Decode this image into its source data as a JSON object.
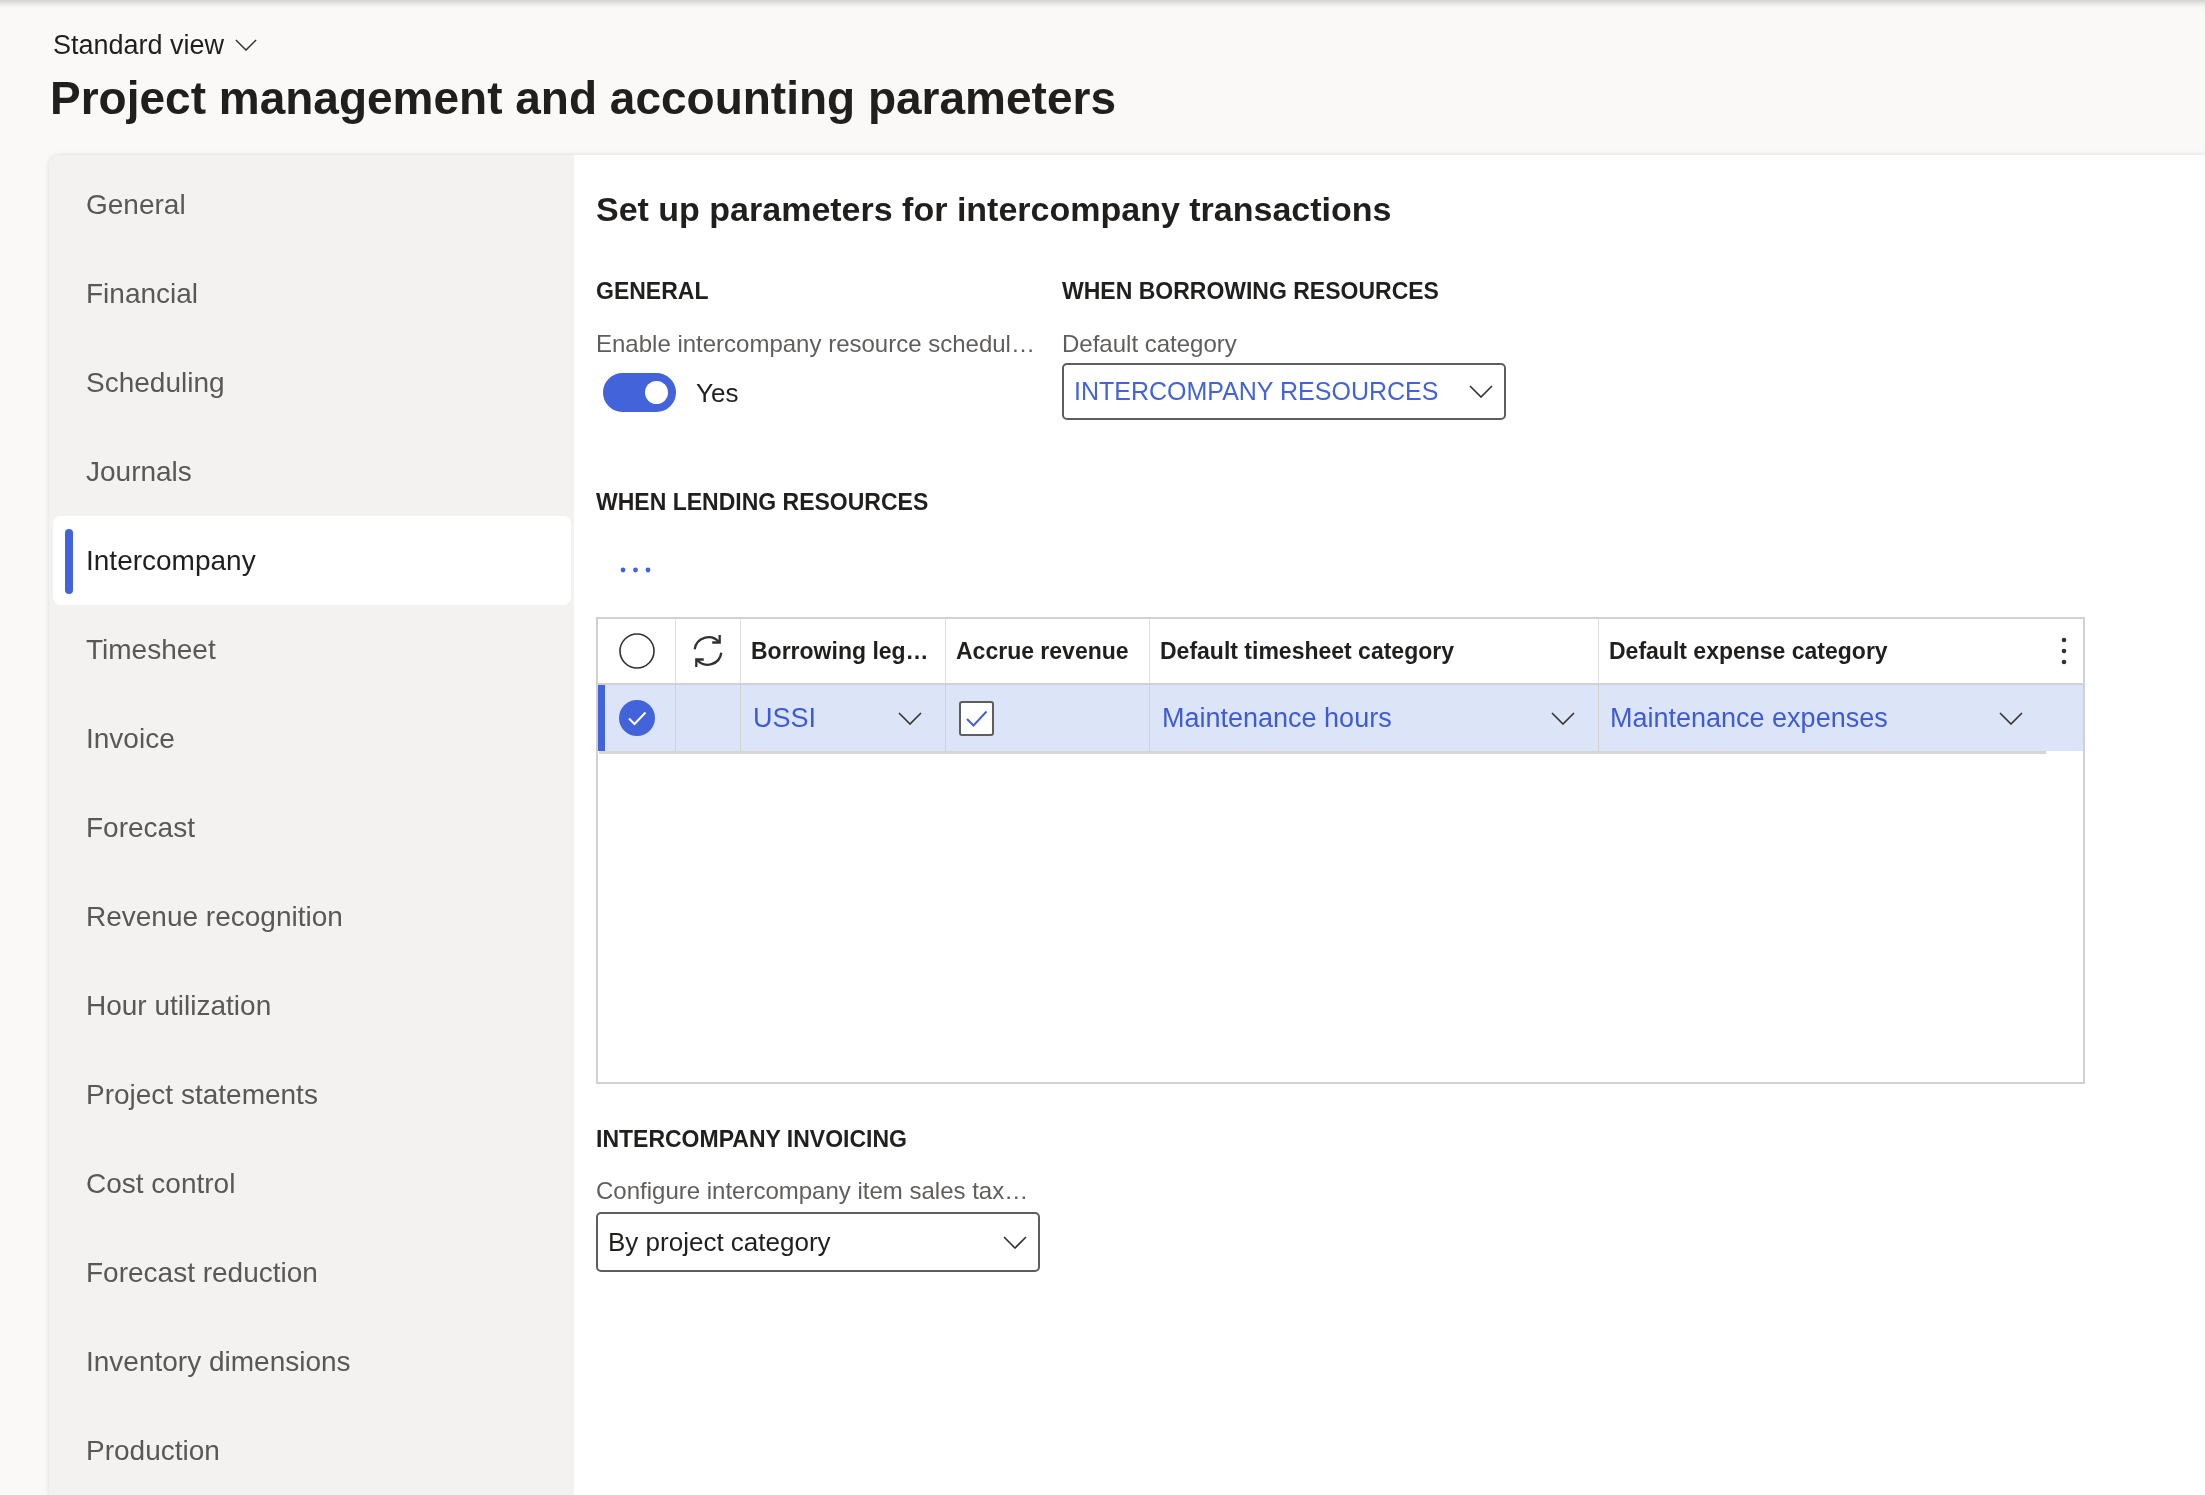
{
  "header": {
    "view_selector": "Standard view",
    "title": "Project management and accounting parameters"
  },
  "sidebar": {
    "items": [
      {
        "label": "General",
        "selected": false
      },
      {
        "label": "Financial",
        "selected": false
      },
      {
        "label": "Scheduling",
        "selected": false
      },
      {
        "label": "Journals",
        "selected": false
      },
      {
        "label": "Intercompany",
        "selected": true
      },
      {
        "label": "Timesheet",
        "selected": false
      },
      {
        "label": "Invoice",
        "selected": false
      },
      {
        "label": "Forecast",
        "selected": false
      },
      {
        "label": "Revenue recognition",
        "selected": false
      },
      {
        "label": "Hour utilization",
        "selected": false
      },
      {
        "label": "Project statements",
        "selected": false
      },
      {
        "label": "Cost control",
        "selected": false
      },
      {
        "label": "Forecast reduction",
        "selected": false
      },
      {
        "label": "Inventory dimensions",
        "selected": false
      },
      {
        "label": "Production",
        "selected": false
      }
    ]
  },
  "content": {
    "heading": "Set up parameters for intercompany transactions",
    "general": {
      "title": "GENERAL",
      "field": {
        "label": "Enable intercompany resource schedul…",
        "on": true,
        "value": "Yes"
      }
    },
    "borrowing": {
      "title": "WHEN BORROWING RESOURCES",
      "field": {
        "label": "Default category",
        "value": "INTERCOMPANY RESOURCES"
      }
    },
    "lending": {
      "title": "WHEN LENDING RESOURCES",
      "table": {
        "columns": [
          {
            "kind": "select",
            "checked": false
          },
          {
            "kind": "refresh"
          },
          {
            "kind": "text",
            "label": "Borrowing leg…"
          },
          {
            "kind": "text",
            "label": "Accrue revenue"
          },
          {
            "kind": "text",
            "label": "Default timesheet category"
          },
          {
            "kind": "text",
            "label": "Default expense category"
          }
        ],
        "rows": [
          {
            "selected": true,
            "cells": [
              {
                "kind": "select"
              },
              {
                "kind": "blank"
              },
              {
                "kind": "dropdown",
                "value": "USSI"
              },
              {
                "kind": "checkbox",
                "checked": true
              },
              {
                "kind": "dropdown",
                "value": "Maintenance hours"
              },
              {
                "kind": "dropdown",
                "value": "Maintenance expenses"
              }
            ]
          }
        ]
      }
    },
    "invoicing": {
      "title": "INTERCOMPANY INVOICING",
      "field": {
        "label": "Configure intercompany item sales tax…",
        "value": "By project category"
      }
    }
  }
}
